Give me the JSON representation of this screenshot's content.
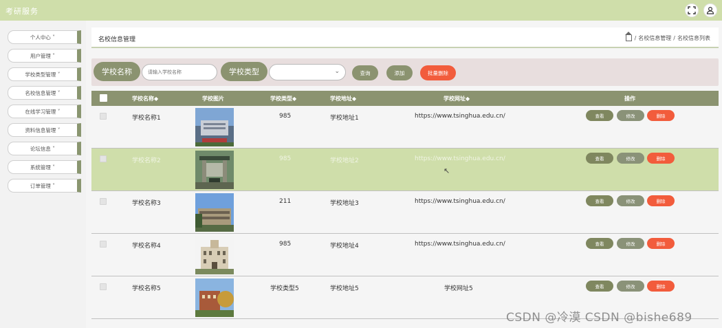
{
  "app": {
    "title": "考研服务"
  },
  "header": {
    "fullscreen_icon": "fullscreen-icon",
    "user_icon": "user-icon"
  },
  "sidebar": {
    "items": [
      {
        "label": "个人中心 ˅"
      },
      {
        "label": "用户管理 ˅"
      },
      {
        "label": "学校类型管理 ˅"
      },
      {
        "label": "名校信息管理 ˅"
      },
      {
        "label": "在线学习管理 ˅"
      },
      {
        "label": "资料信息管理 ˅"
      },
      {
        "label": "论坛信息 ˅"
      },
      {
        "label": "系统管理 ˅"
      },
      {
        "label": "订单管理 ˅"
      }
    ]
  },
  "page": {
    "title": "名校信息管理",
    "breadcrumb": [
      "名校信息管理",
      "/",
      "名校信息列表"
    ]
  },
  "search": {
    "name_label": "学校名称",
    "name_placeholder": "请输入学校名称",
    "type_label": "学校类型",
    "type_value": "",
    "query_button": "查询",
    "add_button": "添加",
    "batch_delete_button": "批量删除"
  },
  "table": {
    "columns": [
      "学校名称◆",
      "学校图片",
      "学校类型◆",
      "学校地址◆",
      "学校网址◆",
      "操作"
    ],
    "rows": [
      {
        "name": "学校名称1",
        "type": "985",
        "address": "学校地址1",
        "url": "https://www.tsinghua.edu.cn/",
        "selected": false
      },
      {
        "name": "学校名称2",
        "type": "985",
        "address": "学校地址2",
        "url": "https://www.tsinghua.edu.cn/",
        "selected": true
      },
      {
        "name": "学校名称3",
        "type": "211",
        "address": "学校地址3",
        "url": "https://www.tsinghua.edu.cn/",
        "selected": false
      },
      {
        "name": "学校名称4",
        "type": "985",
        "address": "学校地址4",
        "url": "https://www.tsinghua.edu.cn/",
        "selected": false
      },
      {
        "name": "学校名称5",
        "type": "学校类型5",
        "address": "学校地址5",
        "url": "学校网址5",
        "selected": false
      }
    ],
    "actions": {
      "view": "查看",
      "edit": "修改",
      "delete": "删除"
    }
  },
  "watermark": "CSDN @冷漠 CSDN @bishe689",
  "colors": {
    "accent": "#8b9370",
    "header": "#cfdeaa",
    "danger": "#f25c3c",
    "selected_row": "#cfdeaa"
  }
}
